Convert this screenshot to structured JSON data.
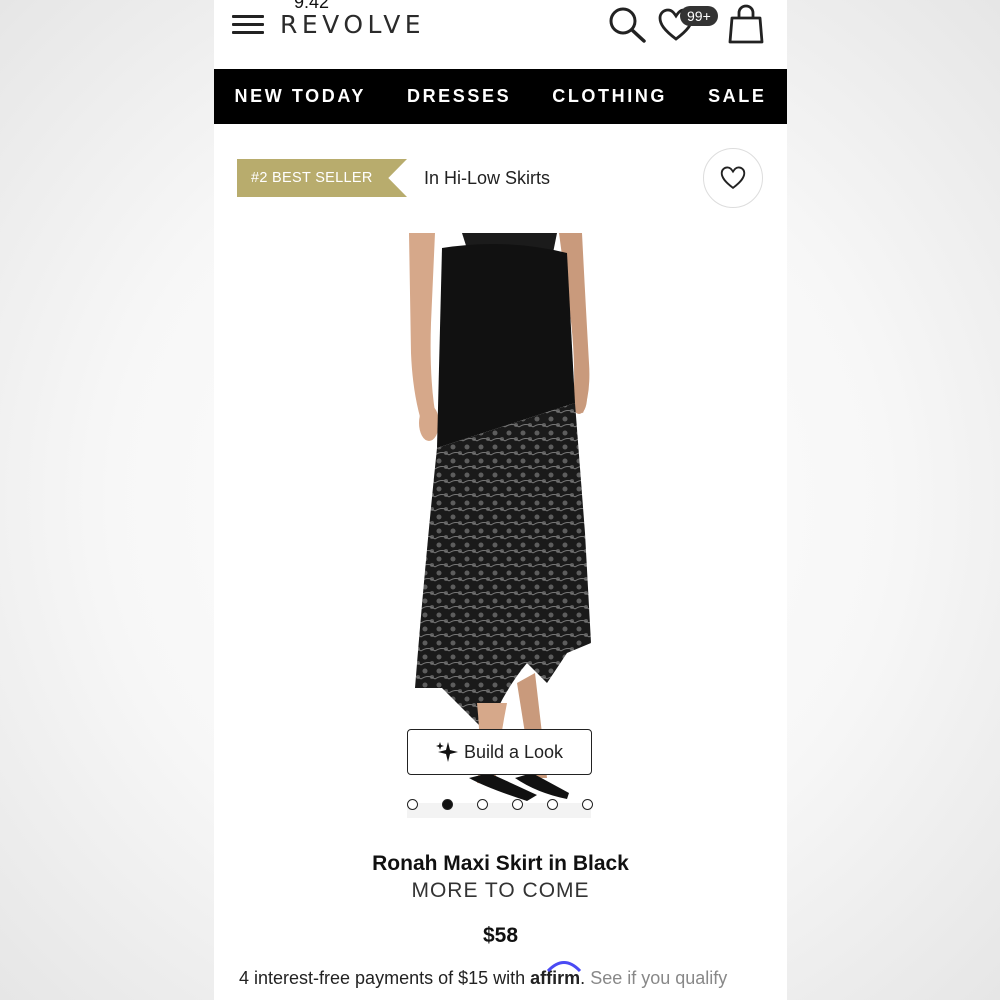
{
  "header": {
    "status_left": "9:42",
    "logo": "REVOLVE",
    "wishlist_badge": "99+"
  },
  "nav": {
    "items": [
      "NEW TODAY",
      "DRESSES",
      "CLOTHING",
      "SALE"
    ]
  },
  "product_meta": {
    "bestseller_badge": "#2 BEST SELLER",
    "category": "In Hi-Low Skirts"
  },
  "gallery": {
    "build_look_label": "Build a Look",
    "dot_count": 6,
    "active_dot": 1
  },
  "product": {
    "title": "Ronah Maxi Skirt in Black",
    "brand": "MORE TO COME",
    "price": "$58"
  },
  "payment": {
    "text": "4 interest-free payments of $15 with ",
    "provider": "affirm",
    "provider_suffix": ". ",
    "qualify_link": "See if you qualify"
  },
  "colors": {
    "badge_gold": "#b8ac6d",
    "nav_bg": "#000000"
  }
}
